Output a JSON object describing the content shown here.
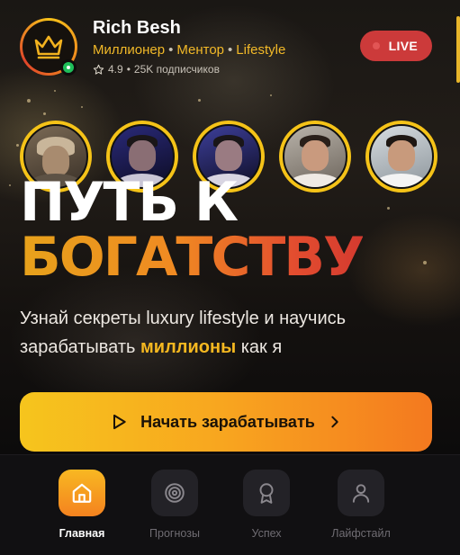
{
  "profile": {
    "name": "Rich Besh",
    "tags": [
      "Миллионер",
      "Ментор",
      "Lifestyle"
    ],
    "rating": "4.9",
    "meta_sep": "•",
    "subscribers": "25K подписчиков",
    "online": true
  },
  "live_badge": {
    "label": "LIVE",
    "color": "#cc3a3a"
  },
  "stories": [
    {
      "label": "story-1"
    },
    {
      "label": "story-2"
    },
    {
      "label": "story-3"
    },
    {
      "label": "story-4"
    },
    {
      "label": "story-5"
    }
  ],
  "hero": {
    "headline_line1": "ПУТЬ К",
    "headline_line2": "БОГАТСТВУ",
    "subtitle_before": "Узнай секреты luxury lifestyle и научись зарабатывать ",
    "subtitle_highlight": "миллионы",
    "subtitle_after": " как я"
  },
  "cta": {
    "label": "Начать зарабатывать"
  },
  "nav": {
    "items": [
      {
        "label": "Главная",
        "icon": "home-icon",
        "active": true
      },
      {
        "label": "Прогнозы",
        "icon": "target-icon",
        "active": false
      },
      {
        "label": "Успех",
        "icon": "award-icon",
        "active": false
      },
      {
        "label": "Лайфстайл",
        "icon": "user-icon",
        "active": false
      }
    ]
  },
  "colors": {
    "accent_gold": "#f5b820",
    "accent_orange": "#f4791f",
    "live_red": "#cc3a3a",
    "online_green": "#1fbf5a"
  }
}
